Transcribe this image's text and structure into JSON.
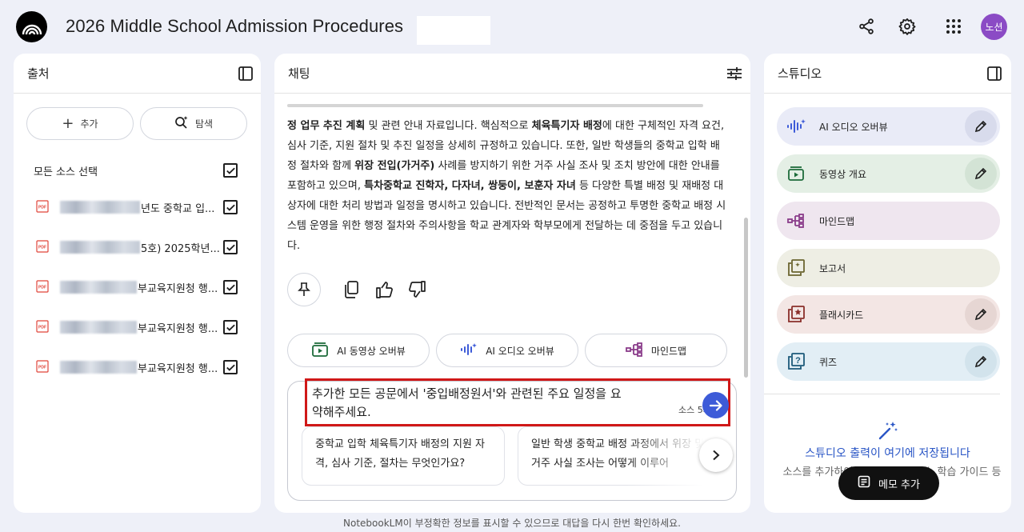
{
  "header": {
    "title": "2026 Middle School Admission Procedures",
    "avatar_text": "노션"
  },
  "sources": {
    "panel_title": "출처",
    "add_label": "추가",
    "discover_label": "탐색",
    "select_all_label": "모든 소스 선택",
    "items": [
      {
        "label": "년도 중학교 입..."
      },
      {
        "label": "5호) 2025학년..."
      },
      {
        "label": "부교육지원청 행..."
      },
      {
        "label": "부교육지원청 행..."
      },
      {
        "label": "부교육지원청 행..."
      }
    ]
  },
  "chat": {
    "panel_title": "채팅",
    "response_html_segments": [
      {
        "t": "정 업무 추진 계획",
        "b": true
      },
      {
        "t": " 및 관련 안내 자료입니다. 핵심적으로 ",
        "b": false
      },
      {
        "t": "체육특기자 배정",
        "b": true
      },
      {
        "t": "에 대한 구체적인 자격 요건, 심사 기준, 지원 절차 및 추진 일정을 상세히 규정하고 있습니다. 또한, 일반 학생들의 중학교 입학 배정 절차와 함께 ",
        "b": false
      },
      {
        "t": "위장 전입(가거주)",
        "b": true
      },
      {
        "t": " 사례를 방지하기 위한 거주 사실 조사 및 조치 방안에 대한 안내를 포함하고 있으며, ",
        "b": false
      },
      {
        "t": "특차중학교 진학자, 다자녀, 쌍둥이, 보훈자 자녀",
        "b": true
      },
      {
        "t": " 등 다양한 특별 배정 및 재배정 대상자에 대한 처리 방법과 일정을 명시하고 있습니다. 전반적인 문서는 공정하고 투명한 중학교 배정 시스템 운영을 위한 행정 절차와 주의사항을 학교 관계자와 학부모에게 전달하는 데 중점을 두고 있습니다.",
        "b": false
      }
    ],
    "chips": [
      {
        "label": "AI 동영상 오버뷰"
      },
      {
        "label": "AI 오디오 오버뷰"
      },
      {
        "label": "마인드맵"
      }
    ],
    "query": "추가한 모든 공문에서 '중입배정원서'와 관련된 주요 일정을 요약해주세요.",
    "source_count": "소스 5개",
    "suggestions": [
      {
        "text": "중학교 입학 체육특기자 배정의 지원 자격, 심사 기준, 절차는 무엇인가요?"
      },
      {
        "text": "일반 학생 중학교 배정 과정에서 위장 및 거주 사실 조사는 어떻게 이루어"
      }
    ],
    "footer_note": "NotebookLM이 부정확한 정보를 표시할 수 있으므로 대답을 다시 한번 확인하세요."
  },
  "studio": {
    "panel_title": "스튜디오",
    "items": [
      {
        "label": "AI 오디오 오버뷰",
        "bg": "#e9ebf7",
        "icon": "audio-waveform-icon",
        "editable": true
      },
      {
        "label": "동영상 개요",
        "bg": "#e4efe5",
        "icon": "video-play-icon",
        "editable": true
      },
      {
        "label": "마인드맵",
        "bg": "#efe6ef",
        "icon": "mindmap-icon",
        "editable": false
      },
      {
        "label": "보고서",
        "bg": "#eeeee4",
        "icon": "report-icon",
        "editable": false
      },
      {
        "label": "플래시카드",
        "bg": "#f3e6e4",
        "icon": "flashcard-icon",
        "editable": true
      },
      {
        "label": "퀴즈",
        "bg": "#e2eef5",
        "icon": "quiz-icon",
        "editable": true
      }
    ],
    "empty_title": "스튜디오 출력이 여기에 저장됩니다",
    "empty_sub": "소스를 추가하여 AI 오디오 오버뷰, 학습 가이드 등을 생성해 보세요.",
    "memo_label": "메모 추가"
  },
  "colors": {
    "page_bg": "#eef0f8",
    "accent_blue": "#3d5bd8",
    "highlight_red": "#d01818",
    "avatar_purple": "#8b4bc5"
  }
}
